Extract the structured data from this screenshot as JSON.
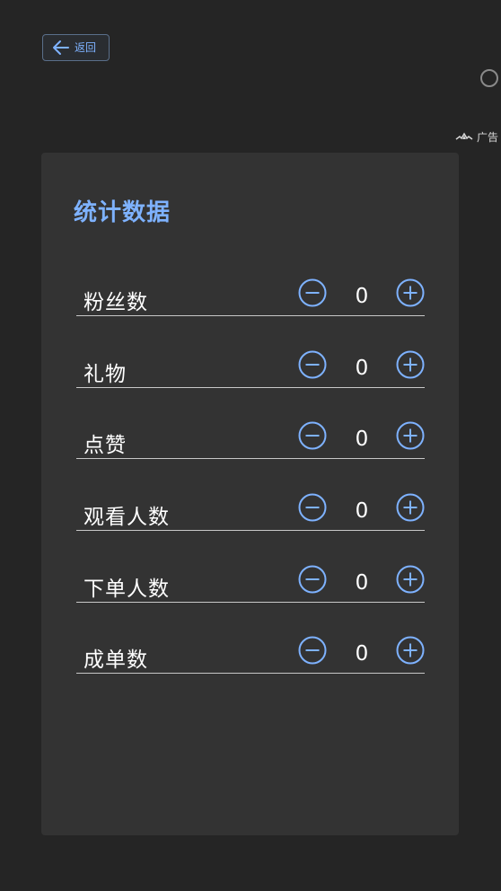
{
  "header": {
    "back_label": "返回"
  },
  "ad": {
    "label": "广告"
  },
  "panel": {
    "title": "统计数据"
  },
  "stats": [
    {
      "label": "粉丝数",
      "value": "0"
    },
    {
      "label": "礼物",
      "value": "0"
    },
    {
      "label": "点赞",
      "value": "0"
    },
    {
      "label": "观看人数",
      "value": "0"
    },
    {
      "label": "下单人数",
      "value": "0"
    },
    {
      "label": "成单数",
      "value": "0"
    }
  ],
  "colors": {
    "accent": "#7eb2ff",
    "background": "#252525",
    "panel": "#333333",
    "divider": "#c8c8c8"
  }
}
